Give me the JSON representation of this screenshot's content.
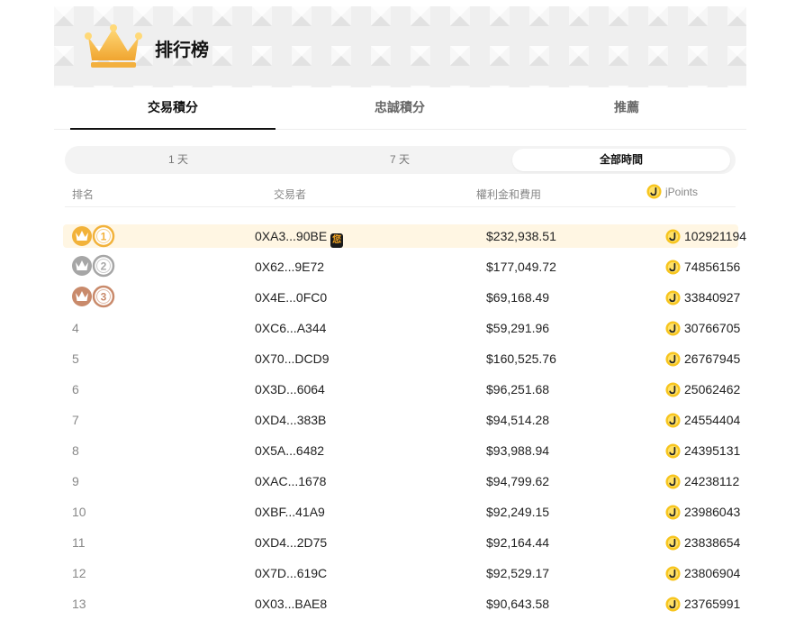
{
  "header": {
    "title": "排行榜"
  },
  "tabs": [
    {
      "label": "交易積分",
      "active": true
    },
    {
      "label": "忠誠積分",
      "active": false
    },
    {
      "label": "推薦",
      "active": false
    }
  ],
  "period": [
    {
      "label": "1 天",
      "active": false
    },
    {
      "label": "7 天",
      "active": false
    },
    {
      "label": "全部時間",
      "active": true
    }
  ],
  "columns": {
    "rank": "排名",
    "trader": "交易者",
    "fees": "權利金和費用",
    "points": "jPoints"
  },
  "you_badge": "您",
  "colors": {
    "gold": "#f2b23a",
    "silver": "#a6a6a6",
    "bronze": "#c98a6b",
    "highlight": "#fff6e3",
    "coin": "#f7c51e"
  },
  "rows": [
    {
      "rank": "1",
      "trader": "0XA3...90BE",
      "fees": "$232,938.51",
      "points": "102921194",
      "you": true
    },
    {
      "rank": "2",
      "trader": "0X62...9E72",
      "fees": "$177,049.72",
      "points": "74856156"
    },
    {
      "rank": "3",
      "trader": "0X4E...0FC0",
      "fees": "$69,168.49",
      "points": "33840927"
    },
    {
      "rank": "4",
      "trader": "0XC6...A344",
      "fees": "$59,291.96",
      "points": "30766705"
    },
    {
      "rank": "5",
      "trader": "0X70...DCD9",
      "fees": "$160,525.76",
      "points": "26767945"
    },
    {
      "rank": "6",
      "trader": "0X3D...6064",
      "fees": "$96,251.68",
      "points": "25062462"
    },
    {
      "rank": "7",
      "trader": "0XD4...383B",
      "fees": "$94,514.28",
      "points": "24554404"
    },
    {
      "rank": "8",
      "trader": "0X5A...6482",
      "fees": "$93,988.94",
      "points": "24395131"
    },
    {
      "rank": "9",
      "trader": "0XAC...1678",
      "fees": "$94,799.62",
      "points": "24238112"
    },
    {
      "rank": "10",
      "trader": "0XBF...41A9",
      "fees": "$92,249.15",
      "points": "23986043"
    },
    {
      "rank": "11",
      "trader": "0XD4...2D75",
      "fees": "$92,164.44",
      "points": "23838654"
    },
    {
      "rank": "12",
      "trader": "0X7D...619C",
      "fees": "$92,529.17",
      "points": "23806904"
    },
    {
      "rank": "13",
      "trader": "0X03...BAE8",
      "fees": "$90,643.58",
      "points": "23765991"
    }
  ]
}
